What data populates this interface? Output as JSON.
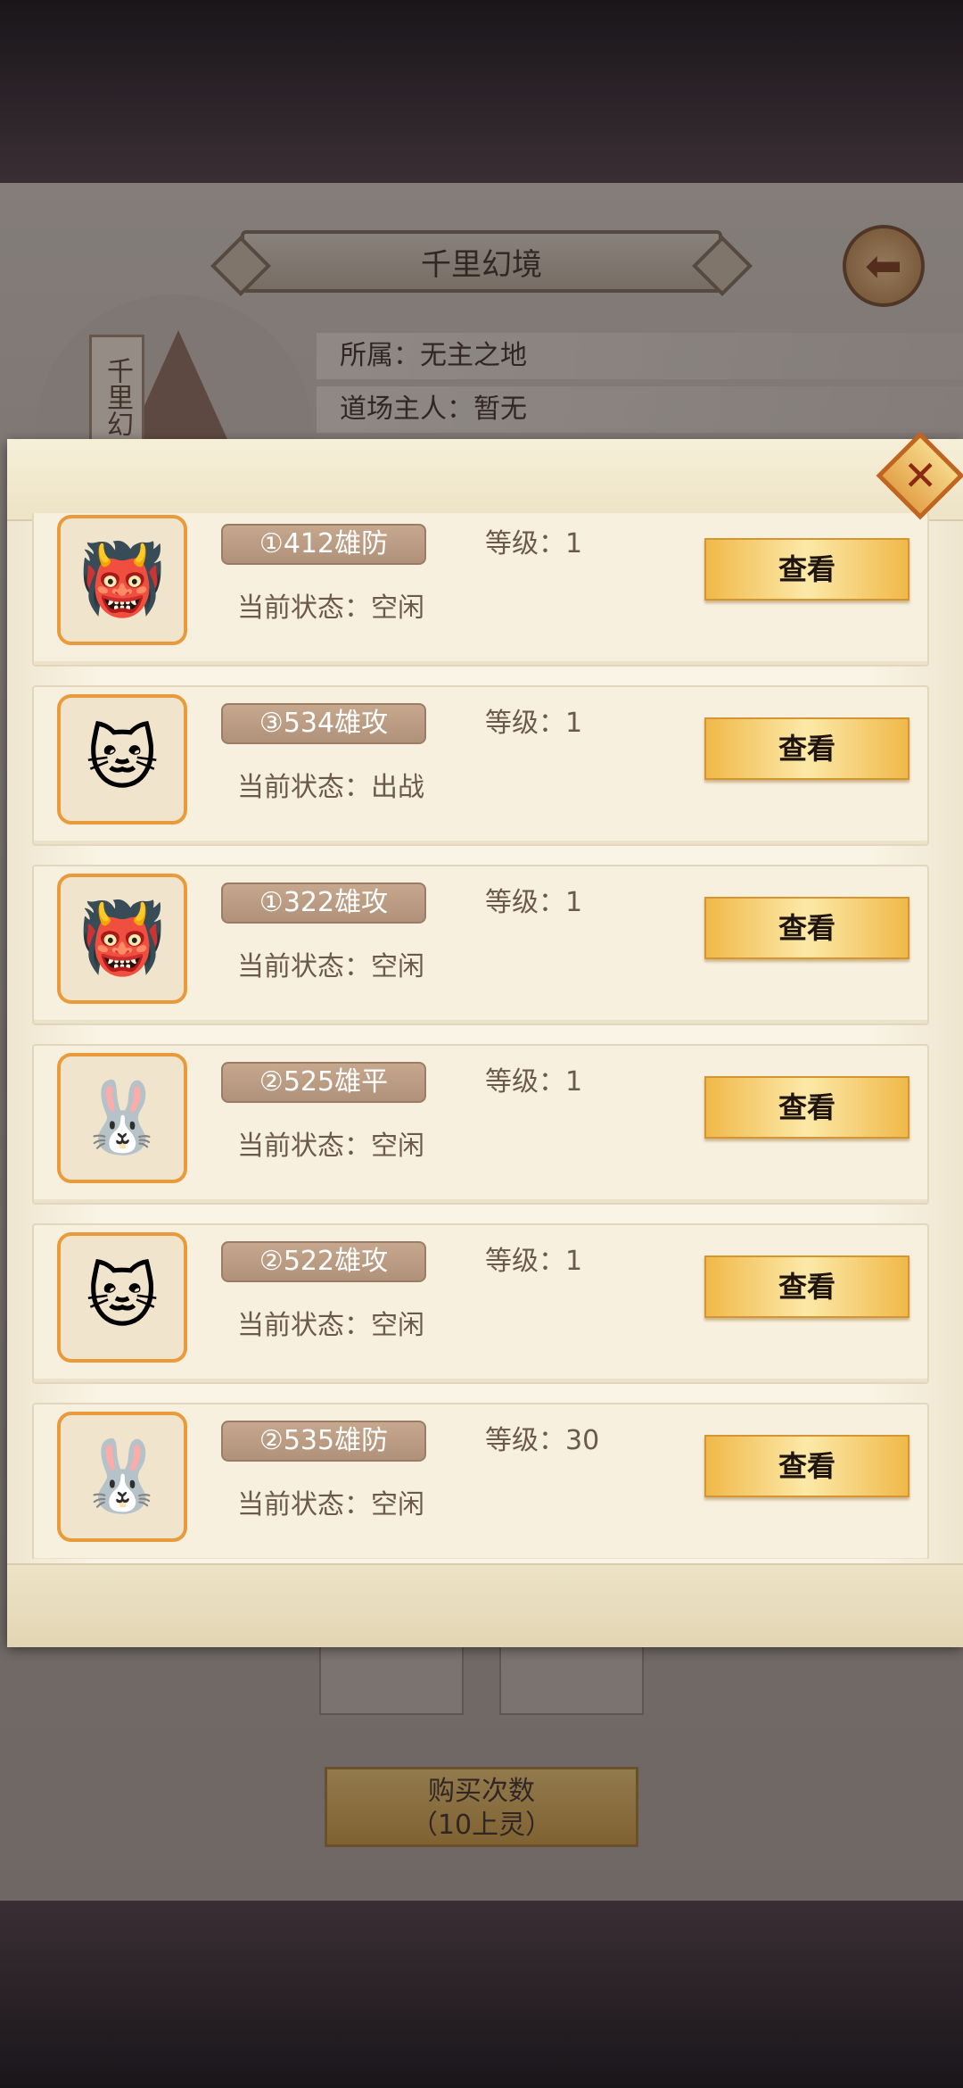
{
  "header": {
    "title": "千里幻境"
  },
  "info": {
    "owner_label": "所属：无主之地",
    "master_label": "道场主人：暂无"
  },
  "portrait": {
    "tag": "千里幻"
  },
  "buy_button": {
    "line1": "购买次数",
    "line2": "（10上灵）"
  },
  "popup": {
    "view_label": "查看",
    "pets": [
      {
        "name": "①412雄防",
        "level": "等级：1",
        "status": "当前状态：空闲",
        "icon": "demon-warrior"
      },
      {
        "name": "③534雄攻",
        "level": "等级：1",
        "status": "当前状态：出战",
        "icon": "white-cat"
      },
      {
        "name": "①322雄攻",
        "level": "等级：1",
        "status": "当前状态：空闲",
        "icon": "demon-warrior"
      },
      {
        "name": "②525雄平",
        "level": "等级：1",
        "status": "当前状态：空闲",
        "icon": "white-rabbit"
      },
      {
        "name": "②522雄攻",
        "level": "等级：1",
        "status": "当前状态：空闲",
        "icon": "white-cat"
      },
      {
        "name": "②535雄防",
        "level": "等级：30",
        "status": "当前状态：空闲",
        "icon": "white-rabbit"
      }
    ]
  }
}
